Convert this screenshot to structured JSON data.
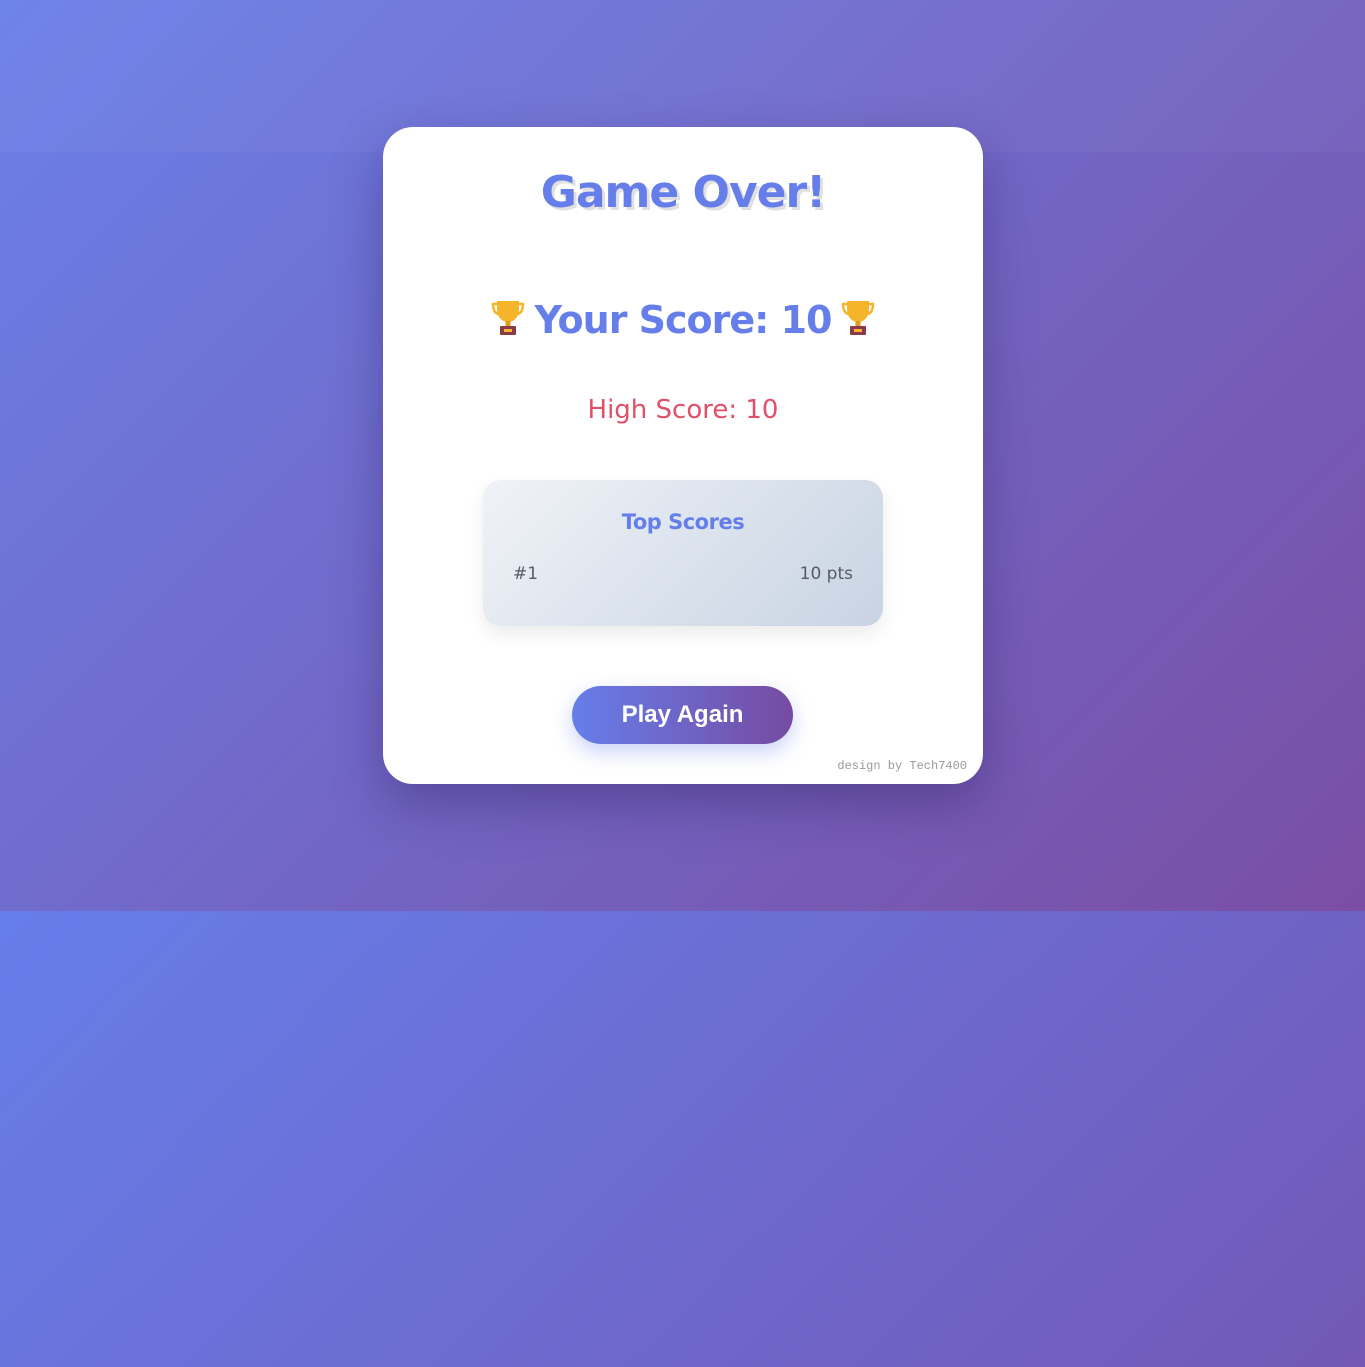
{
  "game_over": {
    "title": "Game Over!",
    "score_text": "Your Score: 10",
    "high_score_text": "High Score: 10",
    "top_scores": {
      "title": "Top Scores",
      "entries": [
        {
          "rank": "#1",
          "points": "10 pts"
        }
      ]
    },
    "play_again_label": "Play Again",
    "credit": "design by Tech7400"
  },
  "icons": {
    "score_left": "trophy-icon",
    "score_right": "trophy-icon"
  },
  "colors": {
    "accent": "#667eea",
    "accent_end": "#764ba2",
    "high_score": "#e05068",
    "text_muted": "#555b66"
  }
}
